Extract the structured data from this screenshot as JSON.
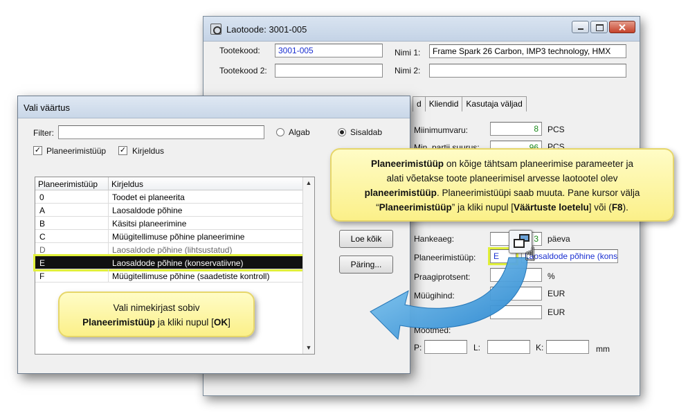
{
  "back_window": {
    "title": "Laotoode: 3001-005",
    "tootekood_label": "Tootekood:",
    "tootekood_value": "3001-005",
    "tootekood2_label": "Tootekood 2:",
    "tootekood2_value": "",
    "nimi1_label": "Nimi 1:",
    "nimi1_value": "Frame Spark 26 Carbon, IMP3 technology, HMX",
    "nimi2_label": "Nimi 2:",
    "nimi2_value": "",
    "tabs": [
      "d",
      "Kliendid",
      "Kasutaja väljad"
    ],
    "miinimumvaru_label": "Miinimumvaru:",
    "miinimumvaru_value": "8",
    "miinimumvaru_unit": "PCS",
    "min_partii_label": "Min. partii suurus:",
    "min_partii_value": "96",
    "min_partii_unit": "PCS",
    "hankeaeg_label": "Hankeaeg:",
    "hankeaeg_value": "3",
    "hankeaeg_unit": "päeva",
    "planeerimistuup_label": "Planeerimistüüp:",
    "planeerimistuup_code": "E",
    "planeerimistuup_desc": "Laosaldode põhine (konse",
    "praagiprotsent_label": "Praagiprotsent:",
    "praagiprotsent_unit": "%",
    "muugihind_label": "Müügihind:",
    "muugihind_unit": "EUR",
    "eur2_unit": "EUR",
    "mootmed_label": "Mõõtmed:",
    "p_label": "P:",
    "l_label": "L:",
    "k_label": "K:",
    "mm_unit": "mm"
  },
  "dialog": {
    "title": "Vali väärtus",
    "filter_label": "Filter:",
    "filter_value": "",
    "radio_algab": "Algab",
    "radio_sisaldab": "Sisaldab",
    "check_planeerimistuup": "Planeerimistüüp",
    "check_kirjeldus": "Kirjeldus",
    "check_mark": "✓",
    "columns": [
      "Planeerimistüüp",
      "Kirjeldus"
    ],
    "rows": [
      {
        "code": "0",
        "desc": "Toodet ei planeerita"
      },
      {
        "code": "A",
        "desc": "Laosaldode põhine"
      },
      {
        "code": "B",
        "desc": "Käsitsi planeerimine"
      },
      {
        "code": "C",
        "desc": "Müügitellimuse põhine planeerimine"
      },
      {
        "code": "D",
        "desc": "Laosaldode põhine (lihtsustatud)"
      },
      {
        "code": "E",
        "desc": "Laosaldode põhine (konservatiivne)"
      },
      {
        "code": "F",
        "desc": "Müügitellimuse põhine (saadetiste kontroll)"
      }
    ],
    "btn_loe_koik": "Loe kõik",
    "btn_paring": "Päring..."
  },
  "callout_top": {
    "l1_b1": "Planeerimistüüp",
    "l1_t1": " on kõige tähtsam planeerimise parameeter ja",
    "l2_t1": "alati võetakse toote planeerimisel arvesse laotootel olev",
    "l3_b1": "planeerimistüüp",
    "l3_t1": ". Planeerimistüüpi saab muuta. Pane kursor välja",
    "l4_t1": "“",
    "l4_b1": "Planeerimistüüp",
    "l4_t2": "” ja kliki nupul [",
    "l4_b2": "Väärtuste loetelu",
    "l4_t3": "] või (",
    "l4_b3": "F8",
    "l4_t4": ")."
  },
  "callout_bottom": {
    "l1_t1": "Vali nimekirjast sobiv",
    "l2_b1": "Planeerimistüüp",
    "l2_t1": " ja kliki nupul [",
    "l2_b2": "OK",
    "l2_t2": "]"
  },
  "colors": {
    "callout_bg": "#fbf089",
    "arrow": "#2c8fd6",
    "selection_glow": "#e1f03a"
  }
}
